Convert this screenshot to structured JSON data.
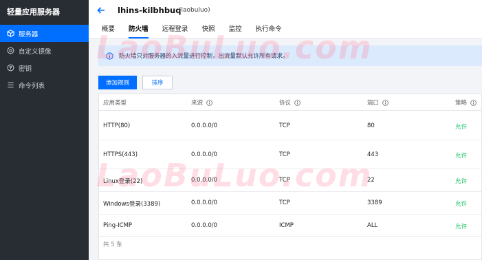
{
  "sidebar": {
    "brand": "轻量应用服务器",
    "items": [
      {
        "label": "服务器",
        "icon": "cube-icon",
        "active": true
      },
      {
        "label": "自定义镜像",
        "icon": "image-icon",
        "active": false
      },
      {
        "label": "密钥",
        "icon": "key-icon",
        "active": false
      },
      {
        "label": "命令列表",
        "icon": "list-icon",
        "active": false
      }
    ]
  },
  "header": {
    "title": "lhins-kilbhbuq",
    "subtitle": "(laobuluo)",
    "tabs": [
      "概要",
      "防火墙",
      "远程登录",
      "快照",
      "监控",
      "执行命令"
    ],
    "active_tab": "防火墙"
  },
  "notice": {
    "text": "防火墙只对服务器的入流量进行控制，出流量默认允许所有请求。"
  },
  "toolbar": {
    "add_label": "添加规则",
    "sort_label": "排序"
  },
  "table": {
    "columns": [
      "应用类型",
      "来源",
      "协议",
      "端口",
      "策略"
    ],
    "rows": [
      {
        "app": "HTTP(80)",
        "source": "0.0.0.0/0",
        "protocol": "TCP",
        "port": "80",
        "policy": "允许"
      },
      {
        "app": "HTTPS(443)",
        "source": "0.0.0.0/0",
        "protocol": "TCP",
        "port": "443",
        "policy": "允许"
      },
      {
        "app": "Linux登录(22)",
        "source": "0.0.0.0/0",
        "protocol": "TCP",
        "port": "22",
        "policy": "允许"
      },
      {
        "app": "Windows登录(3389)",
        "source": "0.0.0.0/0",
        "protocol": "TCP",
        "port": "3389",
        "policy": "允许"
      },
      {
        "app": "Ping-ICMP",
        "source": "0.0.0.0/0",
        "protocol": "ICMP",
        "port": "ALL",
        "policy": "允许"
      }
    ],
    "total": "共 5 条"
  },
  "watermark": {
    "text": "LaoBuLuo.com"
  },
  "colors": {
    "accent": "#006eff",
    "sidebar_bg": "#282c33",
    "allow": "#0abf5b",
    "notice_bg": "#dbeafc"
  }
}
